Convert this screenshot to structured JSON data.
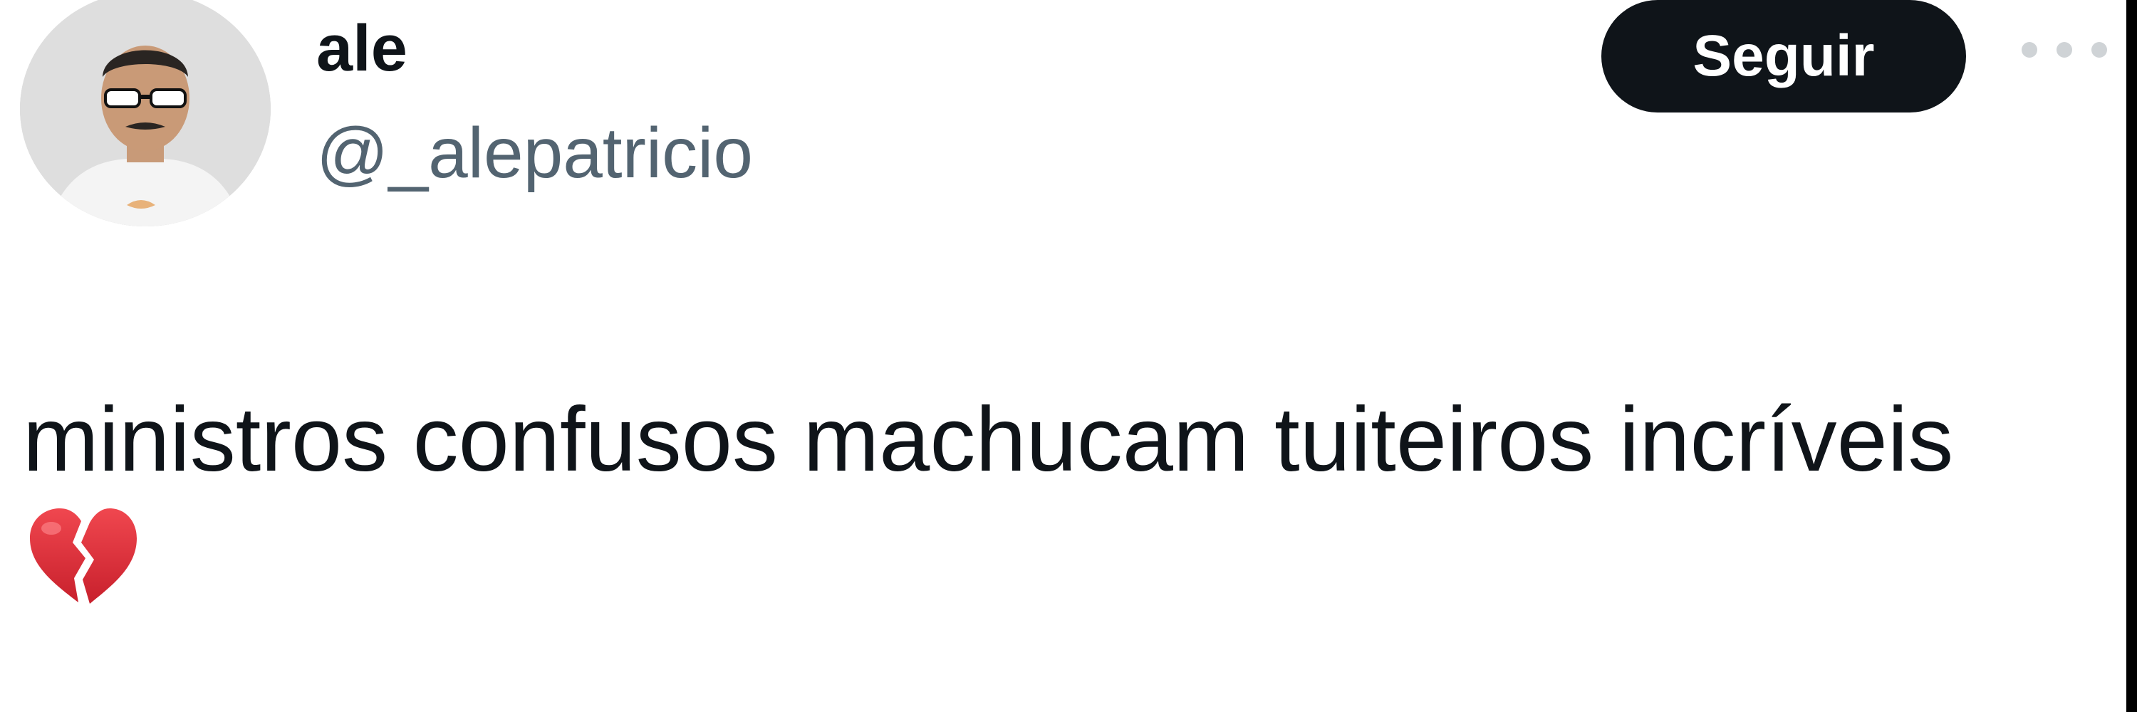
{
  "tweet": {
    "author": {
      "display_name": "ale",
      "handle": "@_alepatricio"
    },
    "follow_label": "Seguir",
    "more_icon": "more-horizontal-icon",
    "text": "ministros confusos machucam tuiteiros incríveis",
    "emoji": "broken-heart-icon"
  },
  "colors": {
    "text_primary": "#0f1419",
    "text_secondary": "#536471",
    "button_bg": "#0f1419",
    "button_text": "#ffffff",
    "emoji_red": "#e0303a"
  }
}
